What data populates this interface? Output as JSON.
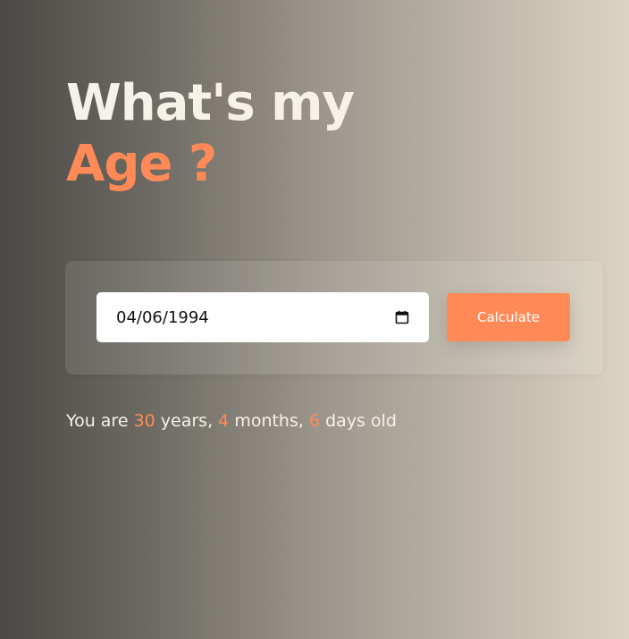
{
  "header": {
    "title_line1": "What's my",
    "title_line2": "Age ?"
  },
  "form": {
    "date_value": "04/06/1994",
    "calendar_icon": "calendar-icon",
    "calculate_label": "Calculate"
  },
  "result": {
    "prefix": "You are",
    "years": "30",
    "years_label": "years,",
    "months": "4",
    "months_label": "months,",
    "days": "6",
    "days_label": "days old"
  },
  "colors": {
    "accent": "#ff8a57",
    "light_text": "#f6f2ea",
    "gradient_start": "#4b4945",
    "gradient_end": "#dcd4c2"
  }
}
